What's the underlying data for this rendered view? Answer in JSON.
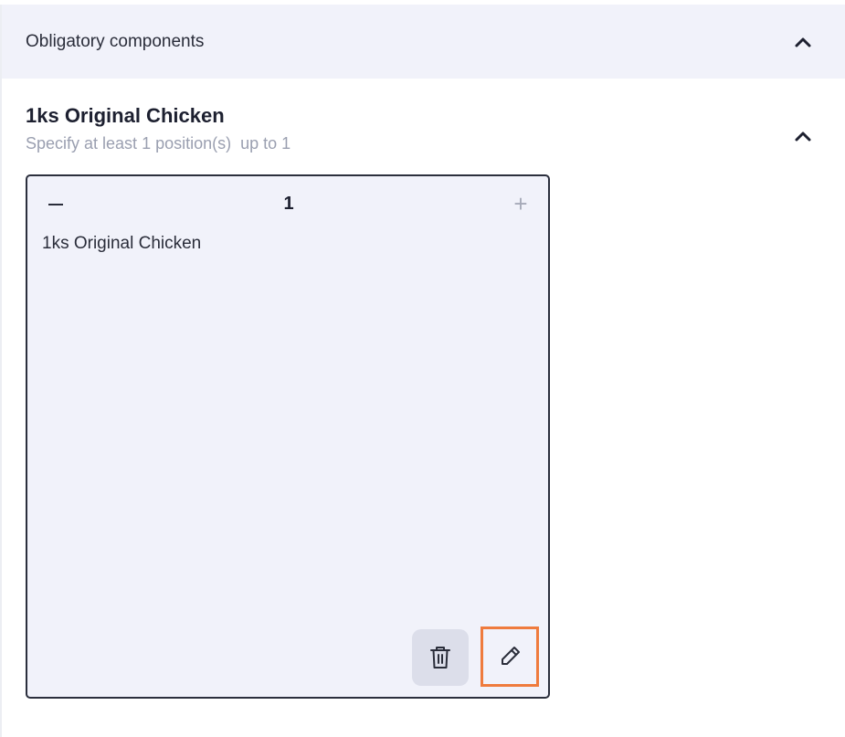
{
  "section": {
    "title": "Obligatory components"
  },
  "group": {
    "title": "1ks Original Chicken",
    "subtitle": "Specify at least 1 position(s)  up to 1"
  },
  "card": {
    "minus_label": "−",
    "quantity": "1",
    "plus_label": "+",
    "item_name": "1ks Original Chicken"
  },
  "icons": {
    "section_toggle": "chevron-up-icon",
    "group_toggle": "chevron-up-icon",
    "delete": "trash-icon",
    "edit": "pencil-icon"
  },
  "colors": {
    "header_bg": "#f1f2fa",
    "card_bg": "#f1f2fa",
    "card_border": "#2b2f3d",
    "highlight": "#ef7b3d",
    "muted_text": "#9a9fb0"
  }
}
